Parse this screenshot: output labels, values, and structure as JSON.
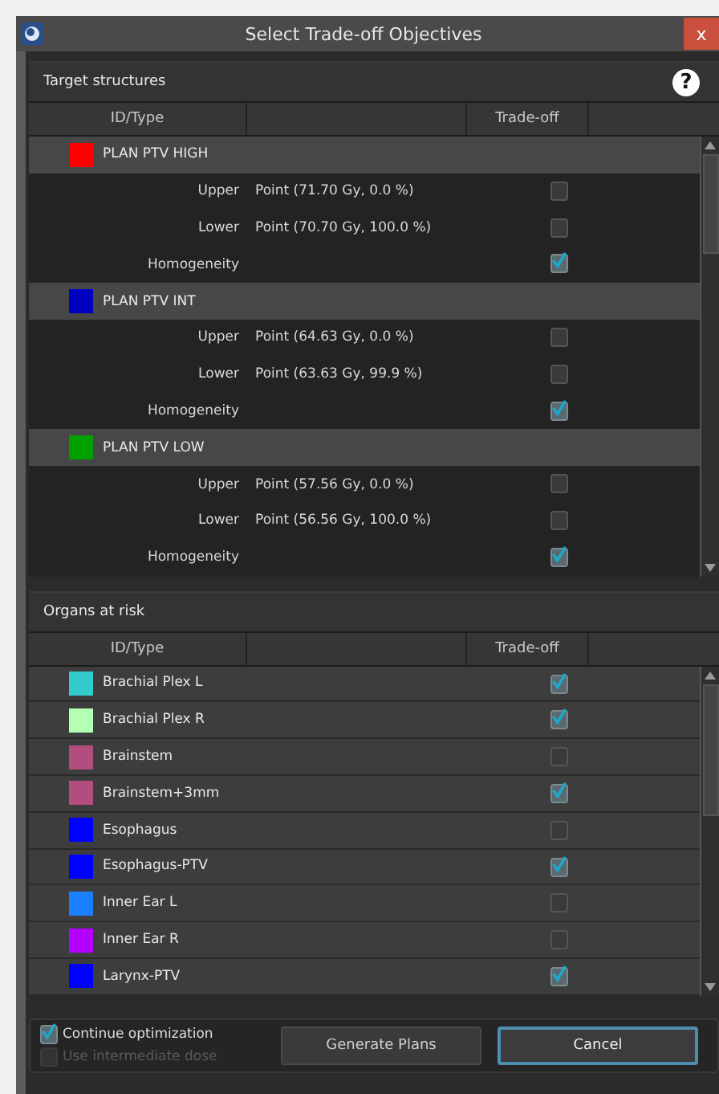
{
  "window": {
    "title": "Select Trade-off Objectives",
    "close": "x"
  },
  "sections": [
    {
      "title": "Target structures",
      "help": "?",
      "columns": [
        "ID/Type",
        "Trade-off"
      ],
      "rows": [
        {
          "kind": "group",
          "name": "PLAN PTV HIGH",
          "color": "#ff0000"
        },
        {
          "kind": "objective",
          "type": "Upper",
          "value": "Point (71.70 Gy, 0.0 %)",
          "checked": false
        },
        {
          "kind": "objective",
          "type": "Lower",
          "value": "Point (70.70 Gy, 100.0 %)",
          "checked": false
        },
        {
          "kind": "objective",
          "type": "Homogeneity",
          "checked": true
        },
        {
          "kind": "group",
          "name": "PLAN PTV INT",
          "color": "#0000c0"
        },
        {
          "kind": "objective",
          "type": "Upper",
          "value": "Point (64.63 Gy, 0.0 %)",
          "checked": false
        },
        {
          "kind": "objective",
          "type": "Lower",
          "value": "Point (63.63 Gy, 99.9 %)",
          "checked": false
        },
        {
          "kind": "objective",
          "type": "Homogeneity",
          "checked": true
        },
        {
          "kind": "group",
          "name": "PLAN PTV LOW",
          "color": "#00a000"
        },
        {
          "kind": "objective",
          "type": "Upper",
          "value": "Point (57.56 Gy, 0.0 %)",
          "checked": false
        },
        {
          "kind": "objective",
          "type": "Lower",
          "value": "Point (56.56 Gy, 100.0 %)",
          "checked": false
        },
        {
          "kind": "objective",
          "type": "Homogeneity",
          "checked": true
        }
      ]
    },
    {
      "title": "Organs at risk",
      "columns": [
        "ID/Type",
        "Trade-off"
      ],
      "rows": [
        {
          "kind": "organ",
          "name": "Brachial Plex L",
          "color": "#33cccc",
          "checked": true
        },
        {
          "kind": "organ",
          "name": "Brachial Plex R",
          "color": "#b3ffb3",
          "checked": true
        },
        {
          "kind": "organ",
          "name": "Brainstem",
          "color": "#b34d80",
          "checked": false
        },
        {
          "kind": "organ",
          "name": "Brainstem+3mm",
          "color": "#b34d80",
          "checked": true
        },
        {
          "kind": "organ",
          "name": "Esophagus",
          "color": "#0000ff",
          "checked": false
        },
        {
          "kind": "organ",
          "name": "Esophagus-PTV",
          "color": "#0000ff",
          "checked": true
        },
        {
          "kind": "organ",
          "name": "Inner Ear L",
          "color": "#1a80ff",
          "checked": false
        },
        {
          "kind": "organ",
          "name": "Inner Ear R",
          "color": "#b300ff",
          "checked": false
        },
        {
          "kind": "organ",
          "name": "Larynx-PTV",
          "color": "#0000ff",
          "checked": true
        }
      ]
    }
  ],
  "options": [
    {
      "label": "Continue optimization",
      "checked": true,
      "disabled": false
    },
    {
      "label": "Use intermediate dose",
      "checked": false,
      "disabled": true
    }
  ],
  "buttons": [
    {
      "label": "Generate Plans",
      "focused": false
    },
    {
      "label": "Cancel",
      "focused": true
    }
  ]
}
